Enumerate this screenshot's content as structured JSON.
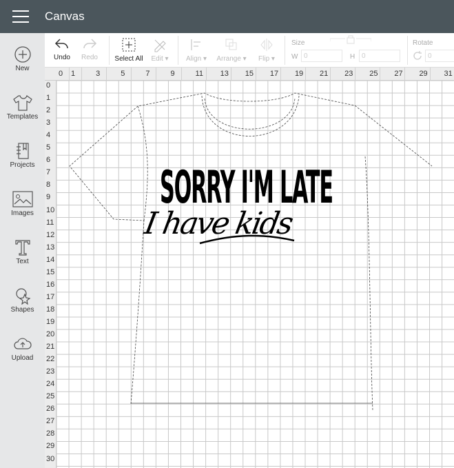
{
  "header": {
    "title": "Canvas"
  },
  "sidebar": {
    "items": [
      {
        "label": "New",
        "icon": "plus-circle-icon"
      },
      {
        "label": "Templates",
        "icon": "tshirt-icon"
      },
      {
        "label": "Projects",
        "icon": "notebook-icon"
      },
      {
        "label": "Images",
        "icon": "image-icon"
      },
      {
        "label": "Text",
        "icon": "text-icon"
      },
      {
        "label": "Shapes",
        "icon": "shapes-icon"
      },
      {
        "label": "Upload",
        "icon": "cloud-upload-icon"
      }
    ]
  },
  "toolbar": {
    "undo": "Undo",
    "redo": "Redo",
    "select_all": "Select All",
    "edit": "Edit ▾",
    "align": "Align ▾",
    "arrange": "Arrange ▾",
    "flip": "Flip ▾",
    "size": "Size",
    "w": "W",
    "w_value": "0",
    "h": "H",
    "h_value": "0",
    "rotate": "Rotate",
    "rotate_value": "0"
  },
  "rulers": {
    "columns": [
      "0",
      "1",
      "3",
      "5",
      "7",
      "9",
      "11",
      "13",
      "15",
      "17",
      "19",
      "21",
      "23",
      "25",
      "27",
      "29",
      "31"
    ],
    "rows": [
      "0",
      "1",
      "2",
      "3",
      "4",
      "5",
      "6",
      "7",
      "8",
      "9",
      "10",
      "11",
      "12",
      "13",
      "14",
      "15",
      "16",
      "17",
      "18",
      "19",
      "20",
      "21",
      "22",
      "23",
      "24",
      "25",
      "26",
      "27",
      "28",
      "29",
      "30"
    ]
  },
  "design": {
    "line1": "SORRY I'M LATE",
    "line2": "I have kids"
  }
}
